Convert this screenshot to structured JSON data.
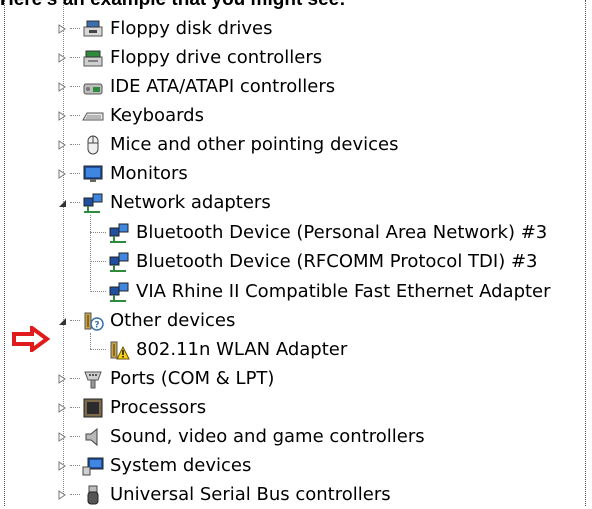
{
  "caption": "Here's an example that you might see:",
  "tree": {
    "items": [
      {
        "label": "Floppy disk drives",
        "icon": "floppy-disk-icon",
        "expander": "collapsed"
      },
      {
        "label": "Floppy drive controllers",
        "icon": "floppy-controller-icon",
        "expander": "collapsed"
      },
      {
        "label": "IDE ATA/ATAPI controllers",
        "icon": "ide-controller-icon",
        "expander": "collapsed"
      },
      {
        "label": "Keyboards",
        "icon": "keyboard-icon",
        "expander": "collapsed"
      },
      {
        "label": "Mice and other pointing devices",
        "icon": "mouse-icon",
        "expander": "collapsed"
      },
      {
        "label": "Monitors",
        "icon": "monitor-icon",
        "expander": "collapsed"
      },
      {
        "label": "Network adapters",
        "icon": "network-adapter-icon",
        "expander": "expanded",
        "children": [
          {
            "label": "Bluetooth Device (Personal Area Network) #3",
            "icon": "network-adapter-icon"
          },
          {
            "label": "Bluetooth Device (RFCOMM Protocol TDI) #3",
            "icon": "network-adapter-icon"
          },
          {
            "label": "VIA Rhine II Compatible Fast Ethernet Adapter",
            "icon": "network-adapter-icon"
          }
        ]
      },
      {
        "label": "Other devices",
        "icon": "unknown-device-icon",
        "expander": "expanded",
        "children": [
          {
            "label": "802.11n WLAN Adapter",
            "icon": "warning-device-icon"
          }
        ]
      },
      {
        "label": "Ports (COM & LPT)",
        "icon": "port-icon",
        "expander": "collapsed"
      },
      {
        "label": "Processors",
        "icon": "processor-icon",
        "expander": "collapsed"
      },
      {
        "label": "Sound, video and game controllers",
        "icon": "speaker-icon",
        "expander": "collapsed"
      },
      {
        "label": "System devices",
        "icon": "system-devices-icon",
        "expander": "collapsed"
      },
      {
        "label": "Universal Serial Bus controllers",
        "icon": "usb-icon",
        "expander": "collapsed"
      }
    ]
  },
  "colors": {
    "highlight_arrow": "#e01b1b",
    "tree_lines": "#888888"
  }
}
